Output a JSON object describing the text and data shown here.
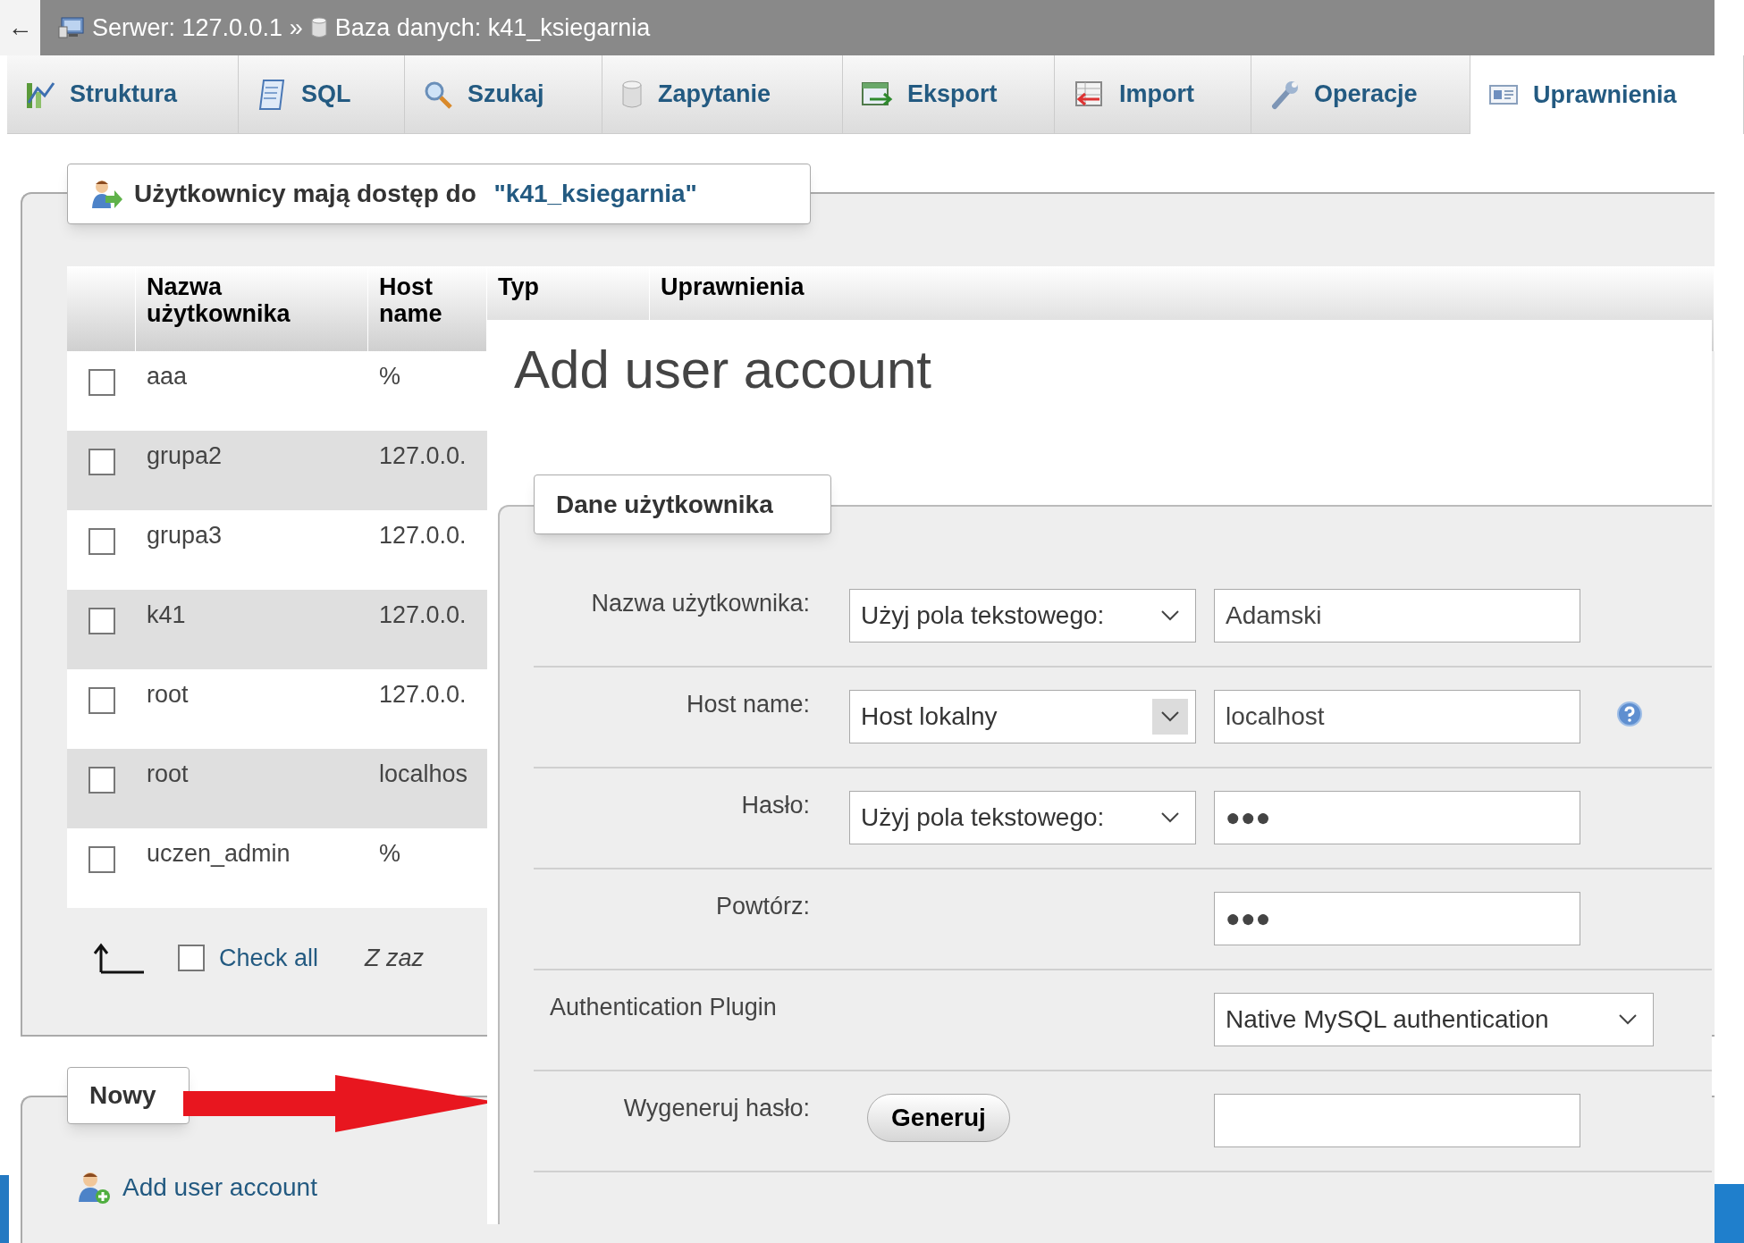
{
  "breadcrumb": {
    "back": "←",
    "server": "Serwer: 127.0.0.1 »",
    "database": "Baza danych: k41_ksiegarnia"
  },
  "tabs": [
    {
      "label": "Struktura",
      "selected": false
    },
    {
      "label": "SQL",
      "selected": false
    },
    {
      "label": "Szukaj",
      "selected": false
    },
    {
      "label": "Zapytanie",
      "selected": false
    },
    {
      "label": "Eksport",
      "selected": false
    },
    {
      "label": "Import",
      "selected": false
    },
    {
      "label": "Operacje",
      "selected": false
    },
    {
      "label": "Uprawnienia",
      "selected": true
    }
  ],
  "users": {
    "legend": "Użytkownicy mają dostęp do",
    "database": "\"k41_ksiegarnia\"",
    "columns": [
      "Nazwa użytkownika",
      "Host name",
      "Typ",
      "Uprawnienia"
    ],
    "rows": [
      {
        "user": "aaa",
        "host": "%",
        "checked": false
      },
      {
        "user": "grupa2",
        "host": "127.0.0.",
        "checked": false
      },
      {
        "user": "grupa3",
        "host": "127.0.0.",
        "checked": false
      },
      {
        "user": "k41",
        "host": "127.0.0.",
        "checked": false
      },
      {
        "user": "root",
        "host": "127.0.0.",
        "checked": false
      },
      {
        "user": "root",
        "host": "localhos",
        "checked": false
      },
      {
        "user": "uczen_admin",
        "host": "%",
        "checked": false
      }
    ],
    "check_all": {
      "label": "Check all",
      "checked": false
    },
    "with_selected": "Z zaz"
  },
  "new": {
    "legend": "Nowy",
    "link": "Add user account"
  },
  "dialog": {
    "title": "Add user account",
    "legend": "Dane użytkownika",
    "fields": [
      {
        "kind": "select_input",
        "label": "Nazwa użytkownika:",
        "select": "Użyj pola tekstowego:",
        "value": "Adamski",
        "highlighted": false,
        "help": false
      },
      {
        "kind": "select_input",
        "label": "Host name:",
        "select": "Host lokalny",
        "value": "localhost",
        "highlighted": true,
        "help": true
      },
      {
        "kind": "select_input",
        "label": "Hasło:",
        "select": "Użyj pola tekstowego:",
        "value": "●●●",
        "highlighted": false,
        "help": false
      },
      {
        "kind": "input",
        "label": "Powtórz:",
        "value": "●●●",
        "help": false
      },
      {
        "kind": "select",
        "label": "Authentication Plugin",
        "select": "Native MySQL authentication",
        "highlighted": false,
        "help": false
      },
      {
        "kind": "button_input",
        "label": "Wygeneruj hasło:",
        "button": "Generuj",
        "help": false
      }
    ]
  }
}
